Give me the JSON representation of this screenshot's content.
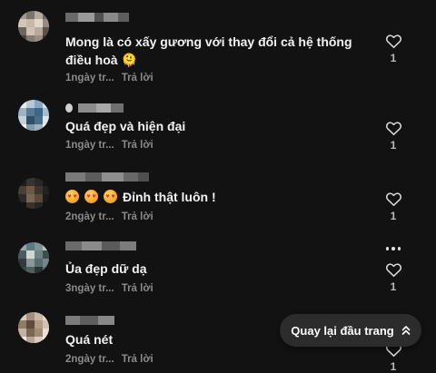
{
  "comments": [
    {
      "text": "Mong là có xấy gương với thay đổi cả hệ thống điều hoà 🫠",
      "time": "1ngày tr...",
      "reply": "Trả lời",
      "likes": "1"
    },
    {
      "text": "Quá đẹp và hiện đại",
      "time": "1ngày tr...",
      "reply": "Trả lời",
      "likes": "1"
    },
    {
      "text": "Đỉnh thật luôn !",
      "emoji_icons": [
        "smiling-face-with-heart-eyes-icon",
        "smiling-face-with-heart-eyes-icon",
        "smiling-face-with-heart-eyes-icon"
      ],
      "time": "2ngày tr...",
      "reply": "Trả lời",
      "likes": "1"
    },
    {
      "text": "Ủa đẹp dữ dạ",
      "time": "3ngày tr...",
      "reply": "Trả lời",
      "likes": "1"
    },
    {
      "text": "Quá nét",
      "time": "2ngày tr...",
      "reply": "Trả lời",
      "likes": "1"
    }
  ],
  "back_to_top_label": "Quay lại đầu trang",
  "colors": {
    "background": "#121212",
    "text": "#f2f2f2",
    "meta": "#8a8a8a",
    "button_bg": "#2c2c2c"
  }
}
